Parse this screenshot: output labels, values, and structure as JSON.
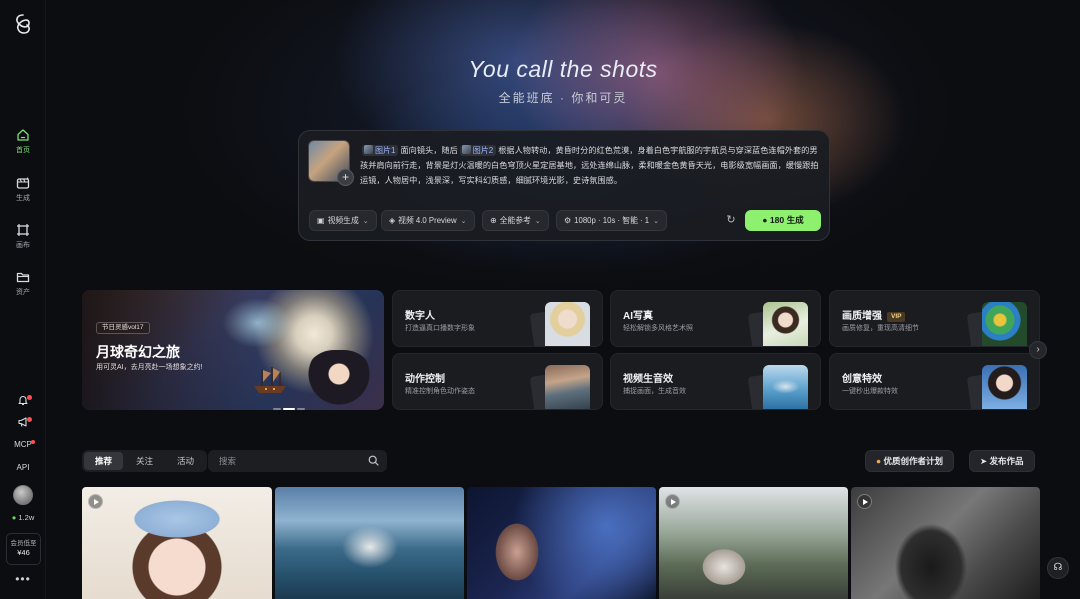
{
  "sidebar": {
    "nav": [
      {
        "label": "首页",
        "icon": "home-icon",
        "active": true
      },
      {
        "label": "生成",
        "icon": "generate-icon",
        "active": false
      },
      {
        "label": "画布",
        "icon": "canvas-icon",
        "active": false
      },
      {
        "label": "资产",
        "icon": "folder-icon",
        "active": false
      }
    ],
    "mcp_label": "MCP",
    "api_label": "API",
    "credits": "1.2w",
    "member_label": "会员低至",
    "member_price": "¥46",
    "more": "•••"
  },
  "hero": {
    "title": "You call the shots",
    "subtitle": "全能班底 · 你和可灵"
  },
  "prompt": {
    "ref1_label": "图片1",
    "ref2_label": "图片2",
    "seg1": "面向镜头，随后",
    "seg2": "根据人物转动，黄昏时分的红色荒漠，身着白色宇航服的宇航员与穿深蓝色连帽外套的男孩并肩向前行走，背景是灯火温暖的白色穹顶火星定居基地，远处连绵山脉，柔和暖金色黄昏天光，电影级宽幅画面，缓慢跟拍运镜，人物居中，浅景深，写实科幻质感，细腻环境光影，史诗氛围感。",
    "mode": "视频生成",
    "model": "视频 4.0 Preview",
    "reference": "全能参考",
    "settings": "1080p · 10s · 智能 · 1",
    "generate_cost": "180",
    "generate_label": "生成"
  },
  "featured": {
    "tag": "节日灵感vol17",
    "title": "月球奇幻之旅",
    "subtitle": "用可灵AI，去月亮赴一场想象之约!"
  },
  "feature_cards": [
    {
      "title": "数字人",
      "subtitle": "打造逼真口播数字形象",
      "vip": false
    },
    {
      "title": "AI写真",
      "subtitle": "轻松解锁多风格艺术照",
      "vip": false
    },
    {
      "title": "画质增强",
      "subtitle": "画质修复，重现高清细节",
      "vip": true
    },
    {
      "title": "动作控制",
      "subtitle": "精准控制角色动作姿态",
      "vip": false
    },
    {
      "title": "视频生音效",
      "subtitle": "捕捉画面，生成音效",
      "vip": false
    },
    {
      "title": "创意特效",
      "subtitle": "一键秒出爆款特效",
      "vip": false
    }
  ],
  "vip_label": "VIP",
  "tabs": [
    "推荐",
    "关注",
    "活动"
  ],
  "search": {
    "placeholder": "搜索"
  },
  "actions": {
    "creator_plan": "优质创作者计划",
    "publish": "发布作品"
  },
  "colors": {
    "accent_green": "#8ef06f",
    "active_nav": "#7fe07a",
    "background": "#0c0d10"
  }
}
